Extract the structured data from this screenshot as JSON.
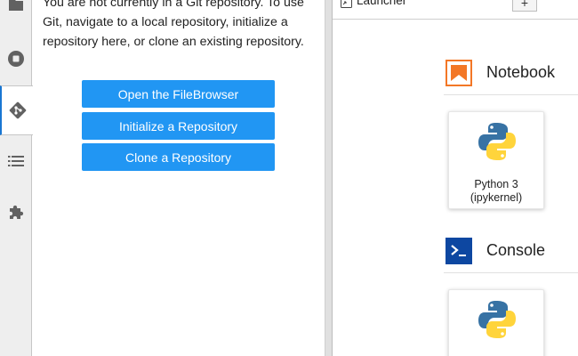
{
  "activity_bar": {
    "tabs": [
      {
        "icon": "folder-icon",
        "name": "file-browser"
      },
      {
        "icon": "stop-circle-icon",
        "name": "running-sessions"
      },
      {
        "icon": "git-icon",
        "name": "git",
        "active": true
      },
      {
        "icon": "list-icon",
        "name": "table-of-contents"
      },
      {
        "icon": "puzzle-piece-icon",
        "name": "extension-manager"
      }
    ]
  },
  "git_panel": {
    "message": "You are not currently in a Git repository. To use Git, navigate to a local repository, initialize a repository here, or clone an existing repository.",
    "buttons": {
      "open_filebrowser": "Open the FileBrowser",
      "initialize_repository": "Initialize a Repository",
      "clone_repository": "Clone a Repository"
    },
    "accent_color": "#2196f3"
  },
  "main": {
    "tab": {
      "label": "Launcher",
      "icon": "launcher-icon"
    },
    "add_tab_label": "+",
    "sections": {
      "notebook": {
        "title": "Notebook",
        "icon": "notebook-icon",
        "icon_color": "#f37726",
        "kernel_line1": "Python 3",
        "kernel_line2": "(ipykernel)"
      },
      "console": {
        "title": "Console",
        "icon": "console-icon",
        "icon_color": "#0d47a1"
      }
    }
  }
}
